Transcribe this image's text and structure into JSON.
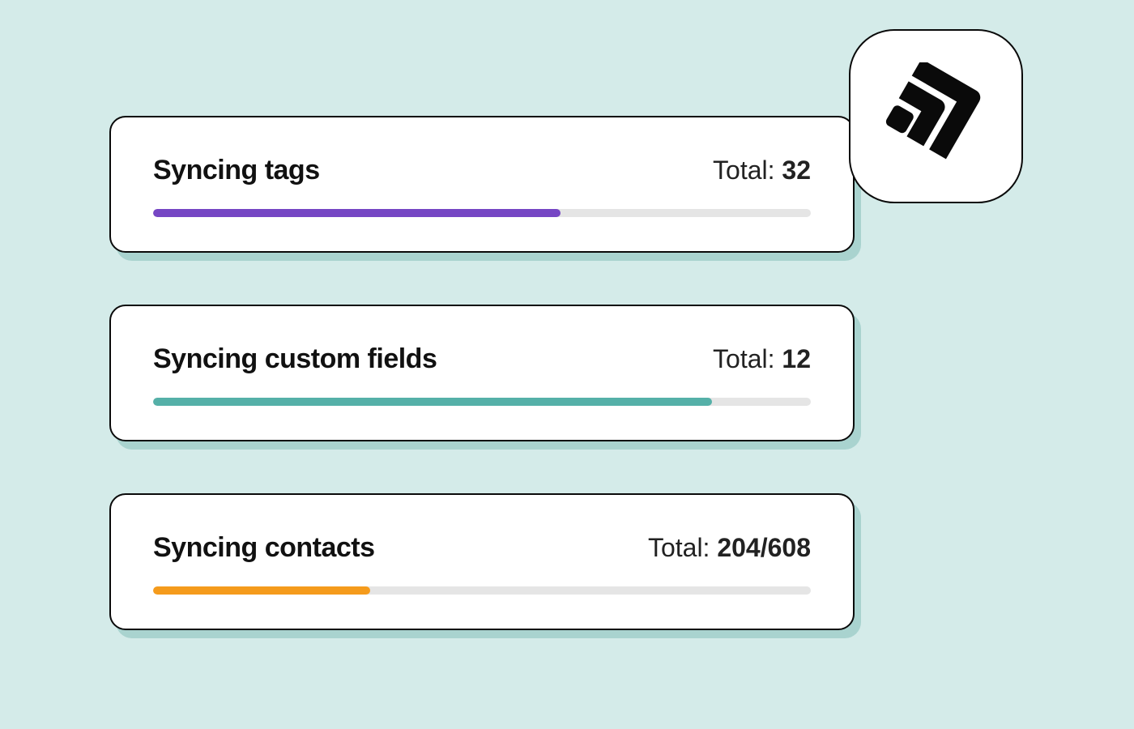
{
  "cards": [
    {
      "title": "Syncing tags",
      "total_label": "Total: ",
      "total_value": "32",
      "progress_percent": 62,
      "color": "#7646C4"
    },
    {
      "title": "Syncing custom fields",
      "total_label": "Total: ",
      "total_value": "12",
      "progress_percent": 85,
      "color": "#55B0A8"
    },
    {
      "title": "Syncing contacts",
      "total_label": "Total: ",
      "total_value": "204/608",
      "progress_percent": 33,
      "color": "#F59B1C"
    }
  ],
  "badge": {
    "icon_name": "signal-icon"
  }
}
